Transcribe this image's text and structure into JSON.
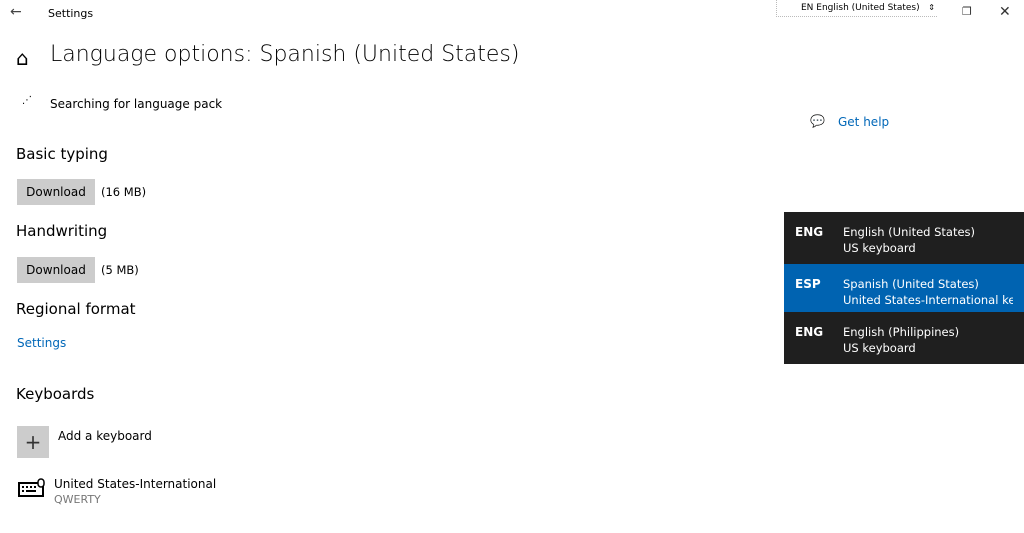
{
  "titlebar": {
    "title": "Settings",
    "input_indicator": "EN English (United States)"
  },
  "header": {
    "title": "Language options: Spanish (United States)"
  },
  "status": {
    "searching": "Searching for language pack"
  },
  "sections": {
    "basic_typing": {
      "heading": "Basic typing",
      "button": "Download",
      "size": "(16 MB)"
    },
    "handwriting": {
      "heading": "Handwriting",
      "button": "Download",
      "size": "(5 MB)"
    },
    "regional_format": {
      "heading": "Regional format",
      "link": "Settings"
    },
    "keyboards": {
      "heading": "Keyboards",
      "add_label": "Add a keyboard",
      "items": [
        {
          "name": "United States-International",
          "layout": "QWERTY"
        }
      ]
    }
  },
  "help": {
    "label": "Get help"
  },
  "flyout": {
    "items": [
      {
        "code": "ENG",
        "language": "English (United States)",
        "keyboard": "US keyboard",
        "selected": false
      },
      {
        "code": "ESP",
        "language": "Spanish (United States)",
        "keyboard": "United States-International ke...",
        "selected": true
      },
      {
        "code": "ENG",
        "language": "English (Philippines)",
        "keyboard": "US keyboard",
        "selected": false
      }
    ]
  }
}
